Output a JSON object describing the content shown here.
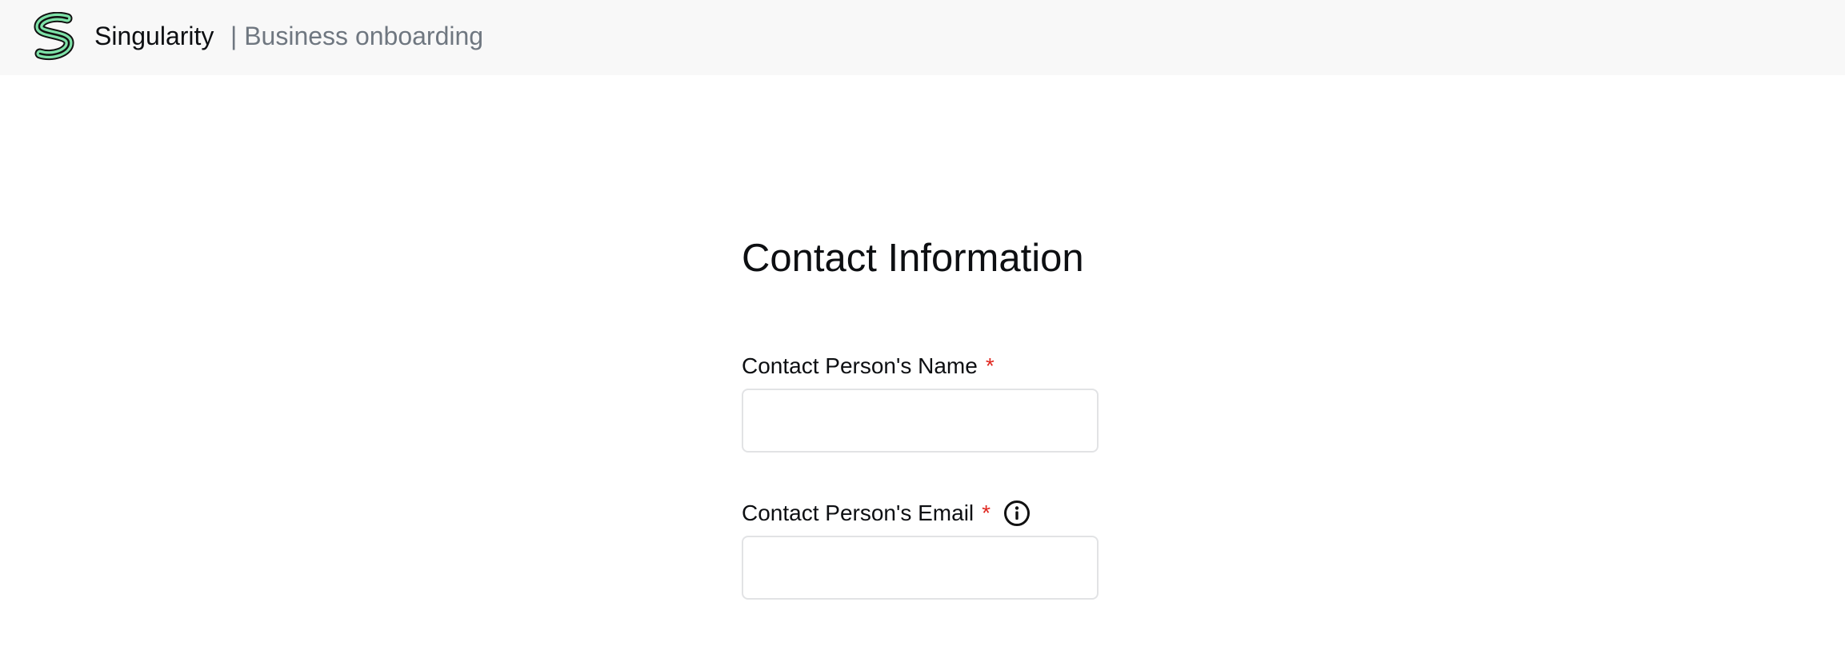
{
  "header": {
    "brand_name": "Singularity",
    "section_title": "| Business onboarding",
    "logo_icon": "singularity-s-logo"
  },
  "form": {
    "title": "Contact Information",
    "fields": [
      {
        "label": "Contact Person's Name",
        "required_marker": "*",
        "value": "",
        "placeholder": ""
      },
      {
        "label": "Contact Person's Email",
        "required_marker": "*",
        "info_icon": "info-circle-icon",
        "value": "",
        "placeholder": ""
      }
    ]
  },
  "colors": {
    "header_bg": "#f8f8f8",
    "logo_green": "#7ee2a8",
    "required_red": "#e0271f",
    "muted_text": "#6f7780",
    "field_border": "#e2e3e5"
  }
}
